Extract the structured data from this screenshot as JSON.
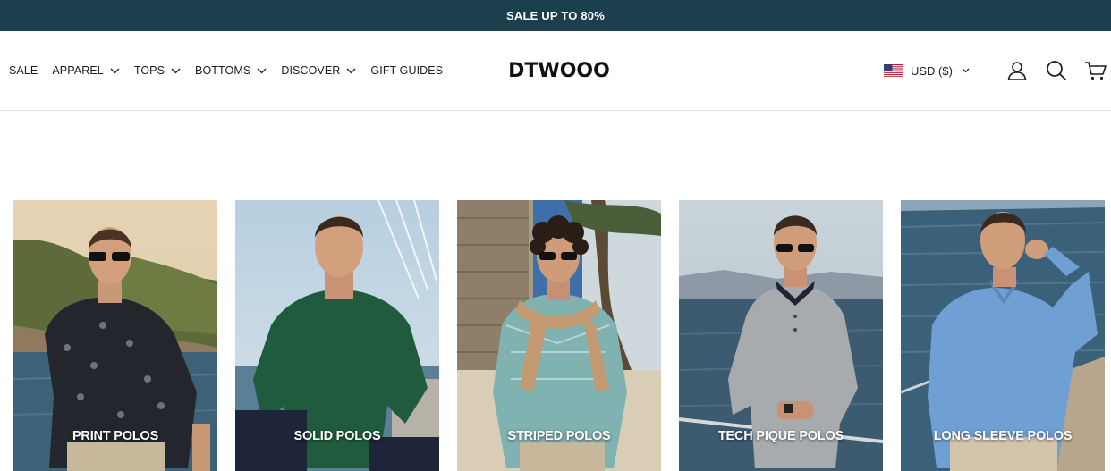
{
  "promo": {
    "text": "SALE UP TO 80%"
  },
  "nav": {
    "items": [
      {
        "label": "SALE",
        "has_dropdown": false
      },
      {
        "label": "APPAREL",
        "has_dropdown": true
      },
      {
        "label": "TOPS",
        "has_dropdown": true
      },
      {
        "label": "BOTTOMS",
        "has_dropdown": true
      },
      {
        "label": "DISCOVER",
        "has_dropdown": true
      },
      {
        "label": "GIFT GUIDES",
        "has_dropdown": false
      }
    ]
  },
  "logo": {
    "text": "DTWOOO"
  },
  "currency": {
    "label": "USD ($)",
    "flag": "us-flag-icon"
  },
  "icons": {
    "account": "user-icon",
    "search": "search-icon",
    "cart": "cart-icon"
  },
  "colors": {
    "promo_bg": "#1c3f4e",
    "text": "#1c1c1c",
    "label": "#ffffff"
  },
  "categories": [
    {
      "label": "PRINT POLOS",
      "shirt_color": "#2b2f36"
    },
    {
      "label": "SOLID POLOS",
      "shirt_color": "#1f5b3c"
    },
    {
      "label": "STRIPED POLOS",
      "shirt_color": "#7fb2b0"
    },
    {
      "label": "TECH PIQUE POLOS",
      "shirt_color": "#a8abae"
    },
    {
      "label": "LONG SLEEVE POLOS",
      "shirt_color": "#6f9fd3"
    }
  ]
}
